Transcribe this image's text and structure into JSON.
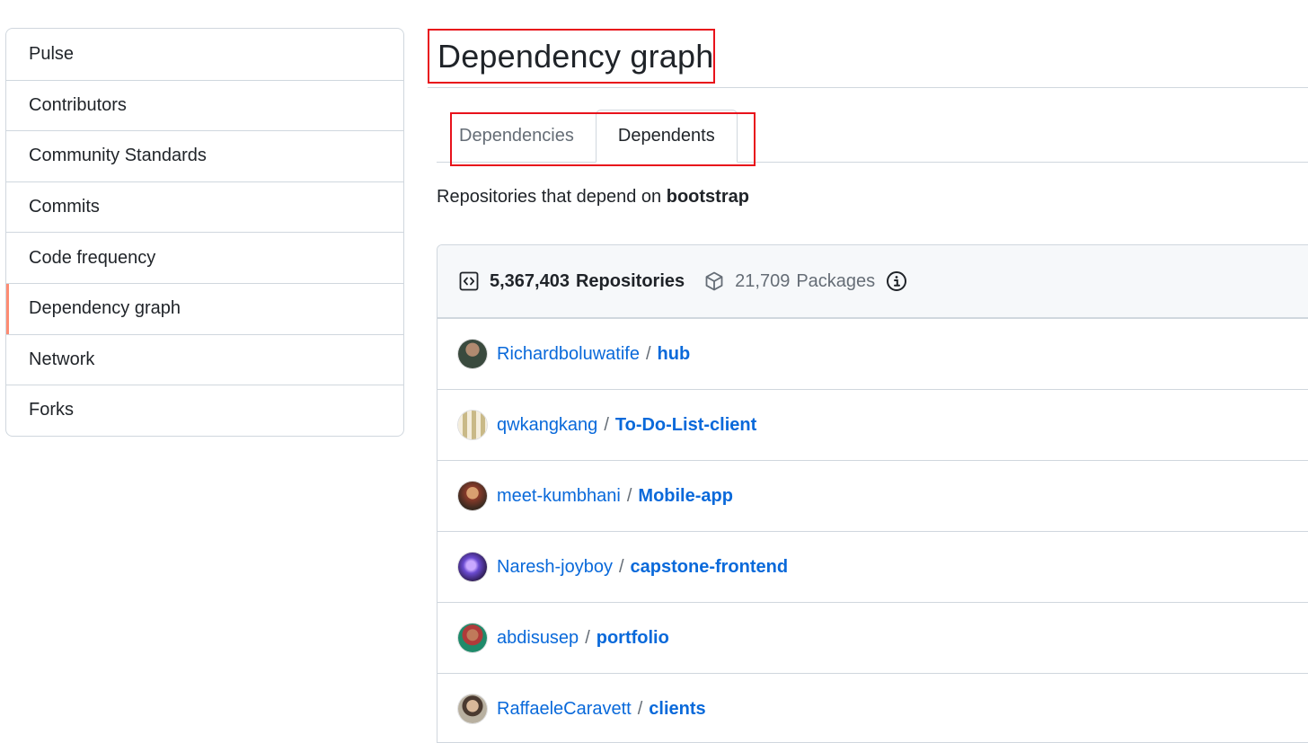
{
  "sidebar": {
    "items": [
      {
        "label": "Pulse"
      },
      {
        "label": "Contributors"
      },
      {
        "label": "Community Standards"
      },
      {
        "label": "Commits"
      },
      {
        "label": "Code frequency"
      },
      {
        "label": "Dependency graph",
        "selected": true
      },
      {
        "label": "Network"
      },
      {
        "label": "Forks"
      }
    ]
  },
  "page": {
    "title": "Dependency graph"
  },
  "tabs": {
    "dependencies_label": "Dependencies",
    "dependents_label": "Dependents",
    "active": "Dependents"
  },
  "subtitle": {
    "prefix": "Repositories that depend on",
    "package": "bootstrap"
  },
  "dependents": {
    "repositories_count": "5,367,403",
    "repositories_label": "Repositories",
    "packages_count": "21,709",
    "packages_label": "Packages",
    "rows": [
      {
        "owner": "Richardboluwatife",
        "repo": "hub",
        "avatar_color": "#3a4a3e"
      },
      {
        "owner": "qwkangkang",
        "repo": "To-Do-List-client",
        "avatar_color": "#c9b987"
      },
      {
        "owner": "meet-kumbhani",
        "repo": "Mobile-app",
        "avatar_color": "#8a3b2a"
      },
      {
        "owner": "Naresh-joyboy",
        "repo": "capstone-frontend",
        "avatar_color": "#4b3a8c"
      },
      {
        "owner": "abdisusep",
        "repo": "portfolio",
        "avatar_color": "#1f8a6a"
      },
      {
        "owner": "RaffaeleCaravett",
        "repo": "clients",
        "avatar_color": "#7a6a58"
      }
    ]
  },
  "colors": {
    "link": "#0969da",
    "selected_indicator": "#fd8c73",
    "annotation_red": "#e8121b",
    "border": "#d0d7de"
  }
}
